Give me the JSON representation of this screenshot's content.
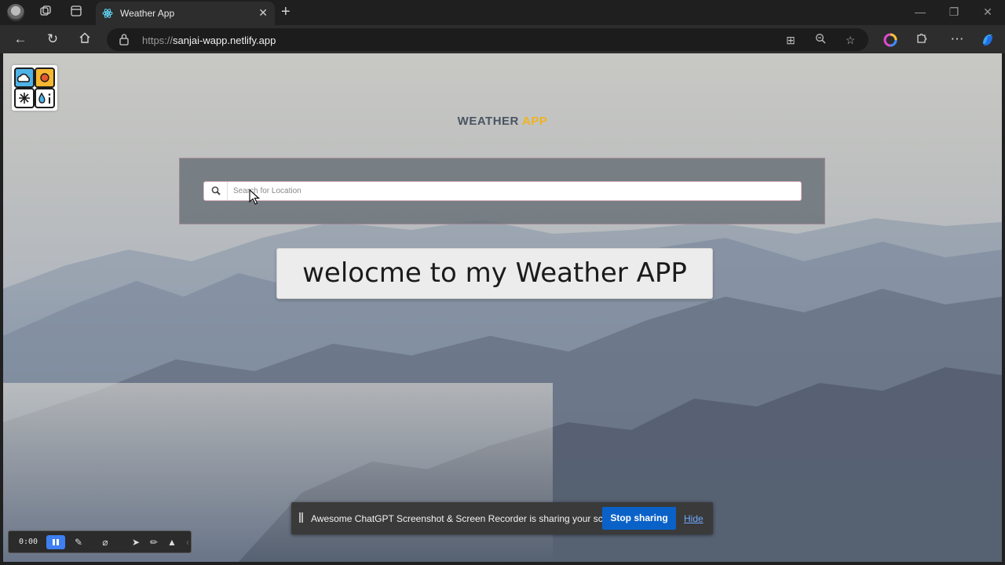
{
  "browser": {
    "tab_title": "Weather App",
    "url_scheme": "https://",
    "url_host": "sanjai-wapp.netlify.app"
  },
  "page": {
    "heading_part1": "WEATHER",
    "heading_part2": "APP",
    "search": {
      "placeholder": "Search for Location",
      "value": ""
    },
    "welcome_text": "welocme to my Weather APP"
  },
  "share_bar": {
    "message": "Awesome ChatGPT Screenshot & Screen Recorder is sharing your screen.",
    "stop_label": "Stop sharing",
    "hide_label": "Hide"
  },
  "recorder": {
    "time": "0:00"
  },
  "colors": {
    "accent_yellow": "#f0b320",
    "stop_button": "#0a62c9",
    "record_pause": "#3e7ff2"
  }
}
